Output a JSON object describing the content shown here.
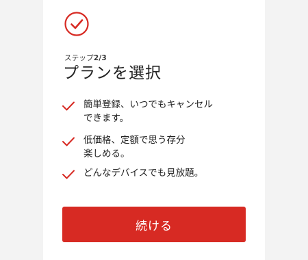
{
  "step": {
    "prefix": "ステップ",
    "value": "2/3"
  },
  "title": "プランを選択",
  "benefits": [
    {
      "line1": "簡単登録、いつでもキャンセル",
      "line2": "できます。"
    },
    {
      "line1": "低価格、定額で思う存分",
      "line2": "楽しめる。"
    },
    {
      "line1": "どんなデバイスでも見放題。",
      "line2": ""
    }
  ],
  "continue_button": {
    "label": "続ける"
  },
  "colors": {
    "accent": "#d72a23",
    "background": "#f3f3f3",
    "card": "#ffffff"
  },
  "icons": {
    "header": "check-circle-icon",
    "benefit": "checkmark-icon"
  }
}
